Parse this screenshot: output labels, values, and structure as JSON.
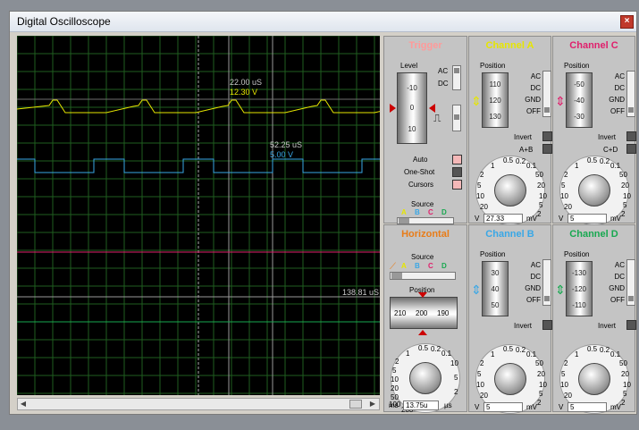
{
  "window": {
    "title": "Digital Oscilloscope",
    "close_label": "×"
  },
  "colors": {
    "channel_a": "#e6e600",
    "channel_b": "#39a7e6",
    "channel_c": "#e0206c",
    "channel_d": "#18a850",
    "horizontal": "#e87c18",
    "trigger": "#ff9a9a",
    "grid": "#1f5e1f"
  },
  "screen": {
    "labels": [
      {
        "id": "t1",
        "time": "22.00 uS",
        "value": "12.30 V"
      },
      {
        "id": "t2",
        "time": "52.25 uS",
        "value": "5.00 V"
      },
      {
        "id": "t3",
        "time": "138.81 uS"
      }
    ]
  },
  "trigger": {
    "title": "Trigger",
    "level_label": "Level",
    "level_ticks": [
      "-10",
      "0",
      "10"
    ],
    "coupling": [
      "AC",
      "DC"
    ],
    "auto_label": "Auto",
    "one_shot_label": "One-Shot",
    "cursors_label": "Cursors",
    "source_label": "Source",
    "source_letters": [
      "A",
      "B",
      "C",
      "D"
    ]
  },
  "channel_a": {
    "title": "Channel A",
    "position_label": "Position",
    "position_ticks": [
      "110",
      "120",
      "130"
    ],
    "modes": [
      "AC",
      "DC",
      "GND",
      "OFF"
    ],
    "invert_label": "Invert",
    "combine_label": "A+B",
    "dial_ticks": [
      "0.5",
      "0.2",
      "0.1",
      "1",
      "2",
      "5",
      "10",
      "20",
      "50",
      "20",
      "10",
      "5",
      "2"
    ],
    "value": "27.33",
    "unit_left": "V",
    "unit_right": "mV"
  },
  "channel_c": {
    "title": "Channel C",
    "position_label": "Position",
    "position_ticks": [
      "-50",
      "-40",
      "-30"
    ],
    "modes": [
      "AC",
      "DC",
      "GND",
      "OFF"
    ],
    "invert_label": "Invert",
    "combine_label": "C+D",
    "dial_ticks": [
      "0.5",
      "0.2",
      "0.1",
      "1",
      "2",
      "5",
      "10",
      "20",
      "50",
      "20",
      "10",
      "5",
      "2"
    ],
    "value": "5",
    "unit_left": "V",
    "unit_right": "mV"
  },
  "horizontal": {
    "title": "Horizontal",
    "source_label": "Source",
    "source_letters": [
      "A",
      "B",
      "C",
      "D"
    ],
    "position_label": "Position",
    "position_ticks": [
      "210",
      "200",
      "190"
    ],
    "dial_ticks": [
      "0.5",
      "0.2",
      "0.1",
      "1",
      "2",
      "5",
      "10",
      "20",
      "50",
      "100",
      "200",
      "10",
      "5",
      "2"
    ],
    "value": "13.75u",
    "unit_left": "ms",
    "unit_right": "µs"
  },
  "channel_b": {
    "title": "Channel B",
    "position_label": "Position",
    "position_ticks": [
      "30",
      "40",
      "50"
    ],
    "modes": [
      "AC",
      "DC",
      "GND",
      "OFF"
    ],
    "invert_label": "Invert",
    "dial_ticks": [
      "0.5",
      "0.2",
      "0.1",
      "1",
      "2",
      "5",
      "10",
      "20",
      "50",
      "20",
      "10",
      "5",
      "2"
    ],
    "value": "5",
    "unit_left": "V",
    "unit_right": "mV"
  },
  "channel_d": {
    "title": "Channel D",
    "position_label": "Position",
    "position_ticks": [
      "-130",
      "-120",
      "-110"
    ],
    "modes": [
      "AC",
      "DC",
      "GND",
      "OFF"
    ],
    "invert_label": "Invert",
    "dial_ticks": [
      "0.5",
      "0.2",
      "0.1",
      "1",
      "2",
      "5",
      "10",
      "20",
      "50",
      "20",
      "10",
      "5",
      "2"
    ],
    "value": "5",
    "unit_left": "V",
    "unit_right": "mV"
  }
}
